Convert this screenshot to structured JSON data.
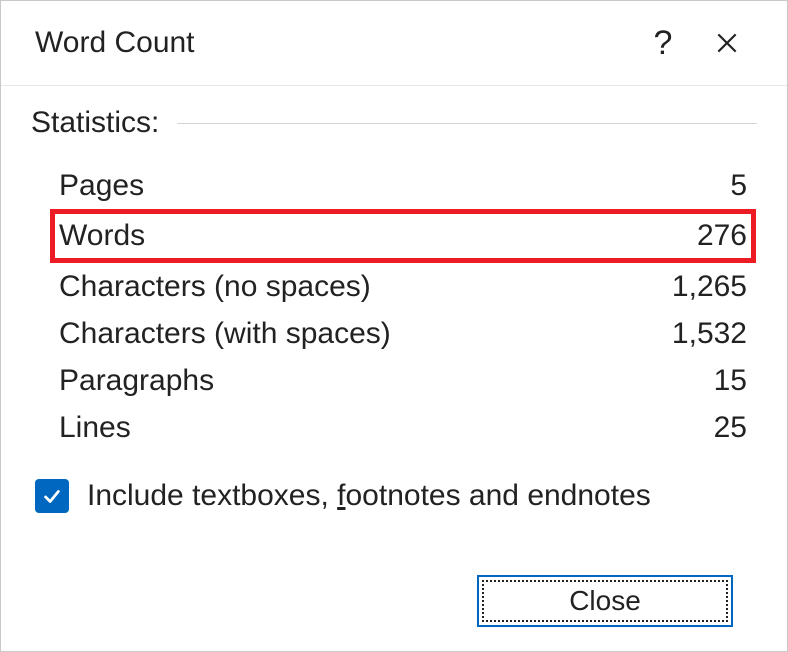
{
  "titlebar": {
    "title": "Word Count",
    "help": "?",
    "close": "✕"
  },
  "section": {
    "label": "Statistics:"
  },
  "stats": {
    "pages": {
      "label": "Pages",
      "value": "5"
    },
    "words": {
      "label": "Words",
      "value": "276"
    },
    "chars_no_spaces": {
      "label": "Characters (no spaces)",
      "value": "1,265"
    },
    "chars_with_spaces": {
      "label": "Characters (with spaces)",
      "value": "1,532"
    },
    "paragraphs": {
      "label": "Paragraphs",
      "value": "15"
    },
    "lines": {
      "label": "Lines",
      "value": "25"
    }
  },
  "checkbox": {
    "checked": true,
    "label_prefix": "Include textboxes, ",
    "label_underline": "f",
    "label_suffix": "ootnotes and endnotes"
  },
  "footer": {
    "close_label": "Close"
  }
}
